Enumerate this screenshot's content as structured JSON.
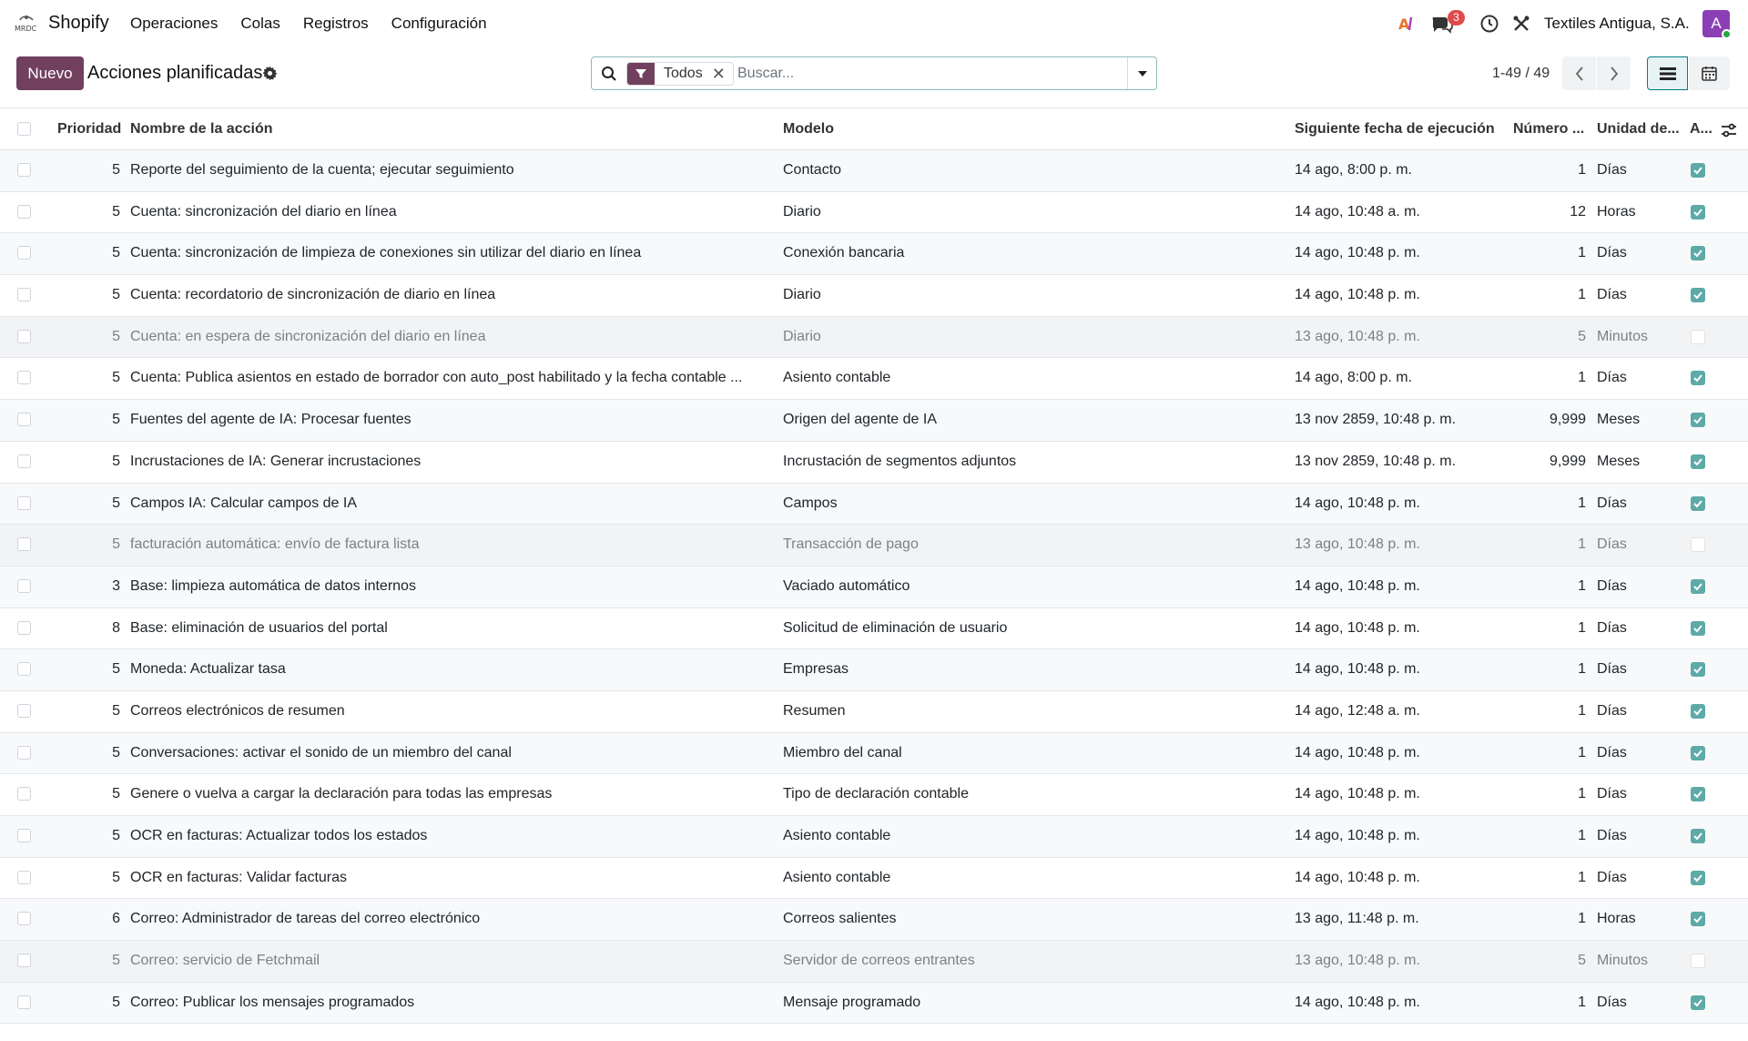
{
  "app": {
    "brand": "Shopify",
    "menu": [
      "Operaciones",
      "Colas",
      "Registros",
      "Configuración"
    ],
    "notifications_count": "3",
    "company": "Textiles Antigua, S.A.",
    "avatar_initial": "A"
  },
  "control": {
    "new_label": "Nuevo",
    "title": "Acciones planificadas",
    "facet_label": "Todos",
    "search_placeholder": "Buscar...",
    "pager": "1-49 / 49"
  },
  "columns": {
    "priority": "Prioridad",
    "name": "Nombre de la acción",
    "model": "Modelo",
    "nextcall": "Siguiente fecha de ejecución",
    "interval_number": "Número ...",
    "interval_type": "Unidad de...",
    "active": "A..."
  },
  "colors": {
    "primary": "#71405f",
    "active_check": "#5daaa7",
    "badge": "#e04a4a"
  },
  "rows": [
    {
      "priority": "5",
      "name": "Reporte del seguimiento de la cuenta; ejecutar seguimiento",
      "model": "Contacto",
      "nextcall": "14 ago, 8:00 p. m.",
      "number": "1",
      "unit": "Días",
      "active": true
    },
    {
      "priority": "5",
      "name": "Cuenta: sincronización del diario en línea",
      "model": "Diario",
      "nextcall": "14 ago, 10:48 a. m.",
      "number": "12",
      "unit": "Horas",
      "active": true
    },
    {
      "priority": "5",
      "name": "Cuenta: sincronización de limpieza de conexiones sin utilizar del diario en línea",
      "model": "Conexión bancaria",
      "nextcall": "14 ago, 10:48 p. m.",
      "number": "1",
      "unit": "Días",
      "active": true
    },
    {
      "priority": "5",
      "name": "Cuenta: recordatorio de sincronización de diario en línea",
      "model": "Diario",
      "nextcall": "14 ago, 10:48 p. m.",
      "number": "1",
      "unit": "Días",
      "active": true
    },
    {
      "priority": "5",
      "name": "Cuenta: en espera de sincronización del diario en línea",
      "model": "Diario",
      "nextcall": "13 ago, 10:48 p. m.",
      "number": "5",
      "unit": "Minutos",
      "active": false
    },
    {
      "priority": "5",
      "name": "Cuenta: Publica asientos en estado de borrador con auto_post habilitado y la fecha contable ...",
      "model": "Asiento contable",
      "nextcall": "14 ago, 8:00 p. m.",
      "number": "1",
      "unit": "Días",
      "active": true
    },
    {
      "priority": "5",
      "name": "Fuentes del agente de IA: Procesar fuentes",
      "model": "Origen del agente de IA",
      "nextcall": "13 nov 2859, 10:48 p. m.",
      "number": "9,999",
      "unit": "Meses",
      "active": true
    },
    {
      "priority": "5",
      "name": "Incrustaciones de IA: Generar incrustaciones",
      "model": "Incrustación de segmentos adjuntos",
      "nextcall": "13 nov 2859, 10:48 p. m.",
      "number": "9,999",
      "unit": "Meses",
      "active": true
    },
    {
      "priority": "5",
      "name": "Campos IA: Calcular campos de IA",
      "model": "Campos",
      "nextcall": "14 ago, 10:48 p. m.",
      "number": "1",
      "unit": "Días",
      "active": true
    },
    {
      "priority": "5",
      "name": "facturación automática: envío de factura lista",
      "model": "Transacción de pago",
      "nextcall": "13 ago, 10:48 p. m.",
      "number": "1",
      "unit": "Días",
      "active": false
    },
    {
      "priority": "3",
      "name": "Base: limpieza automática de datos internos",
      "model": "Vaciado automático",
      "nextcall": "14 ago, 10:48 p. m.",
      "number": "1",
      "unit": "Días",
      "active": true
    },
    {
      "priority": "8",
      "name": "Base: eliminación de usuarios del portal",
      "model": "Solicitud de eliminación de usuario",
      "nextcall": "14 ago, 10:48 p. m.",
      "number": "1",
      "unit": "Días",
      "active": true
    },
    {
      "priority": "5",
      "name": "Moneda: Actualizar tasa",
      "model": "Empresas",
      "nextcall": "14 ago, 10:48 p. m.",
      "number": "1",
      "unit": "Días",
      "active": true
    },
    {
      "priority": "5",
      "name": "Correos electrónicos de resumen",
      "model": "Resumen",
      "nextcall": "14 ago, 12:48 a. m.",
      "number": "1",
      "unit": "Días",
      "active": true
    },
    {
      "priority": "5",
      "name": "Conversaciones: activar el sonido de un miembro del canal",
      "model": "Miembro del canal",
      "nextcall": "14 ago, 10:48 p. m.",
      "number": "1",
      "unit": "Días",
      "active": true
    },
    {
      "priority": "5",
      "name": "Genere o vuelva a cargar la declaración para todas las empresas",
      "model": "Tipo de declaración contable",
      "nextcall": "14 ago, 10:48 p. m.",
      "number": "1",
      "unit": "Días",
      "active": true
    },
    {
      "priority": "5",
      "name": "OCR en facturas: Actualizar todos los estados",
      "model": "Asiento contable",
      "nextcall": "14 ago, 10:48 p. m.",
      "number": "1",
      "unit": "Días",
      "active": true
    },
    {
      "priority": "5",
      "name": "OCR en facturas: Validar facturas",
      "model": "Asiento contable",
      "nextcall": "14 ago, 10:48 p. m.",
      "number": "1",
      "unit": "Días",
      "active": true
    },
    {
      "priority": "6",
      "name": "Correo: Administrador de tareas del correo electrónico",
      "model": "Correos salientes",
      "nextcall": "13 ago, 11:48 p. m.",
      "number": "1",
      "unit": "Horas",
      "active": true
    },
    {
      "priority": "5",
      "name": "Correo: servicio de Fetchmail",
      "model": "Servidor de correos entrantes",
      "nextcall": "13 ago, 10:48 p. m.",
      "number": "5",
      "unit": "Minutos",
      "active": false
    },
    {
      "priority": "5",
      "name": "Correo: Publicar los mensajes programados",
      "model": "Mensaje programado",
      "nextcall": "14 ago, 10:48 p. m.",
      "number": "1",
      "unit": "Días",
      "active": true
    }
  ]
}
